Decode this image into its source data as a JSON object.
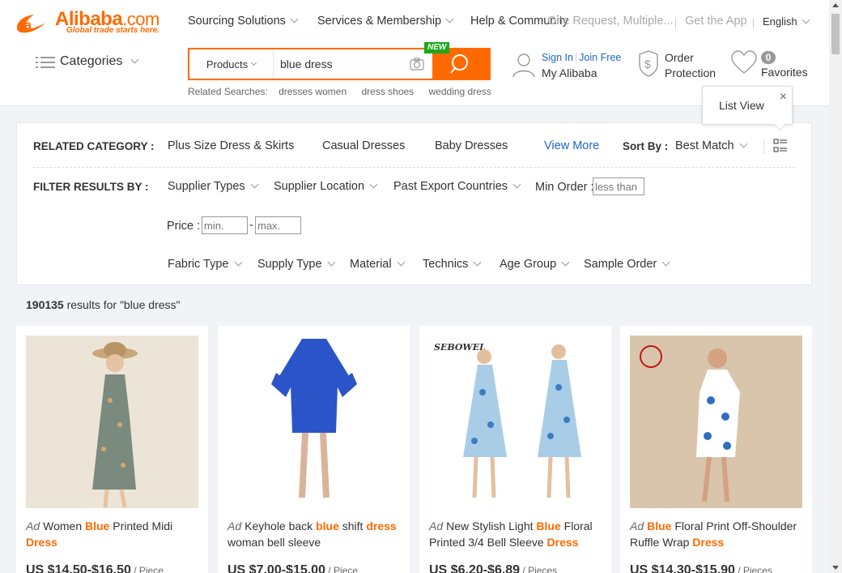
{
  "header": {
    "logo": {
      "word": "Alibaba",
      "suffix": ".com",
      "tagline": "Global trade starts here."
    },
    "nav": {
      "sourcing": "Sourcing Solutions",
      "services": "Services & Membership",
      "help": "Help & Community",
      "overlay": "One Request, Multiple...",
      "app": "Get the App",
      "language": "English"
    },
    "categories_label": "Categories",
    "search": {
      "category": "Products",
      "query": "blue dress",
      "new_badge": "NEW"
    },
    "related": {
      "label": "Related Searches:",
      "items": [
        "dresses women",
        "dress shoes",
        "wedding dress"
      ]
    },
    "account": {
      "sign_in": "Sign In",
      "join": "Join Free",
      "my_alibaba": "My Alibaba"
    },
    "order": {
      "line1": "Order",
      "line2": "Protection"
    },
    "favorites": {
      "count": "0",
      "label": "Favorites"
    },
    "tooltip": {
      "text": "List View",
      "close": "×"
    }
  },
  "filters": {
    "related_category_label": "RELATED CATEGORY :",
    "related_categories": [
      "Plus Size Dress & Skirts",
      "Casual Dresses",
      "Baby Dresses"
    ],
    "view_more": "View More",
    "sort_label": "Sort By :",
    "sort_value": "Best Match",
    "filter_label": "FILTER RESULTS BY :",
    "row1": [
      "Supplier Types",
      "Supplier Location",
      "Past Export Countries"
    ],
    "min_order_label": "Min Order :",
    "min_order_placeholder": "less than",
    "price_label": "Price :",
    "price_min_placeholder": "min.",
    "price_dash": "-",
    "price_max_placeholder": "max.",
    "row3": [
      "Fabric Type",
      "Supply Type",
      "Material",
      "Technics",
      "Age Group",
      "Sample Order"
    ]
  },
  "results": {
    "count": "190135",
    "text": " results for \"blue dress\""
  },
  "products": [
    {
      "ad": "Ad",
      "pre": "Women ",
      "hl1": "Blue",
      "mid": " Printed Midi ",
      "hl2": "Dress",
      "post": "",
      "price": "US $14.50-$16.50",
      "unit": " / Piece"
    },
    {
      "ad": "Ad",
      "pre": "Keyhole back ",
      "hl1": "blue",
      "mid": " shift ",
      "hl2": "dress",
      "post": " woman bell sleeve",
      "price": "US $7.00-$15.00",
      "unit": " / Piece"
    },
    {
      "ad": "Ad",
      "pre": "New Stylish Light ",
      "hl1": "Blue",
      "mid": " Floral Printed 3/4 Bell Sleeve ",
      "hl2": "Dress",
      "post": "",
      "price": "US $6.20-$6.89",
      "unit": " / Pieces"
    },
    {
      "ad": "Ad",
      "pre": "",
      "hl1": "Blue",
      "mid": " Floral Print Off-Shoulder Ruffle Wrap ",
      "hl2": "Dress",
      "post": "",
      "price": "US $14.30-$15.90",
      "unit": " / Pieces"
    }
  ],
  "product_images": [
    {
      "bg": "#ece4d7",
      "dress": "#7b8a7f"
    },
    {
      "bg": "#ffffff",
      "dress": "#2b54c8"
    },
    {
      "bg": "#ffffff",
      "dress": "#a9cde6",
      "brand": "SEBOWEL"
    },
    {
      "bg": "#d9c4ac",
      "dress": "#ffffff"
    }
  ],
  "colors": {
    "accent": "#ff6a00",
    "link": "#1a66c6"
  }
}
